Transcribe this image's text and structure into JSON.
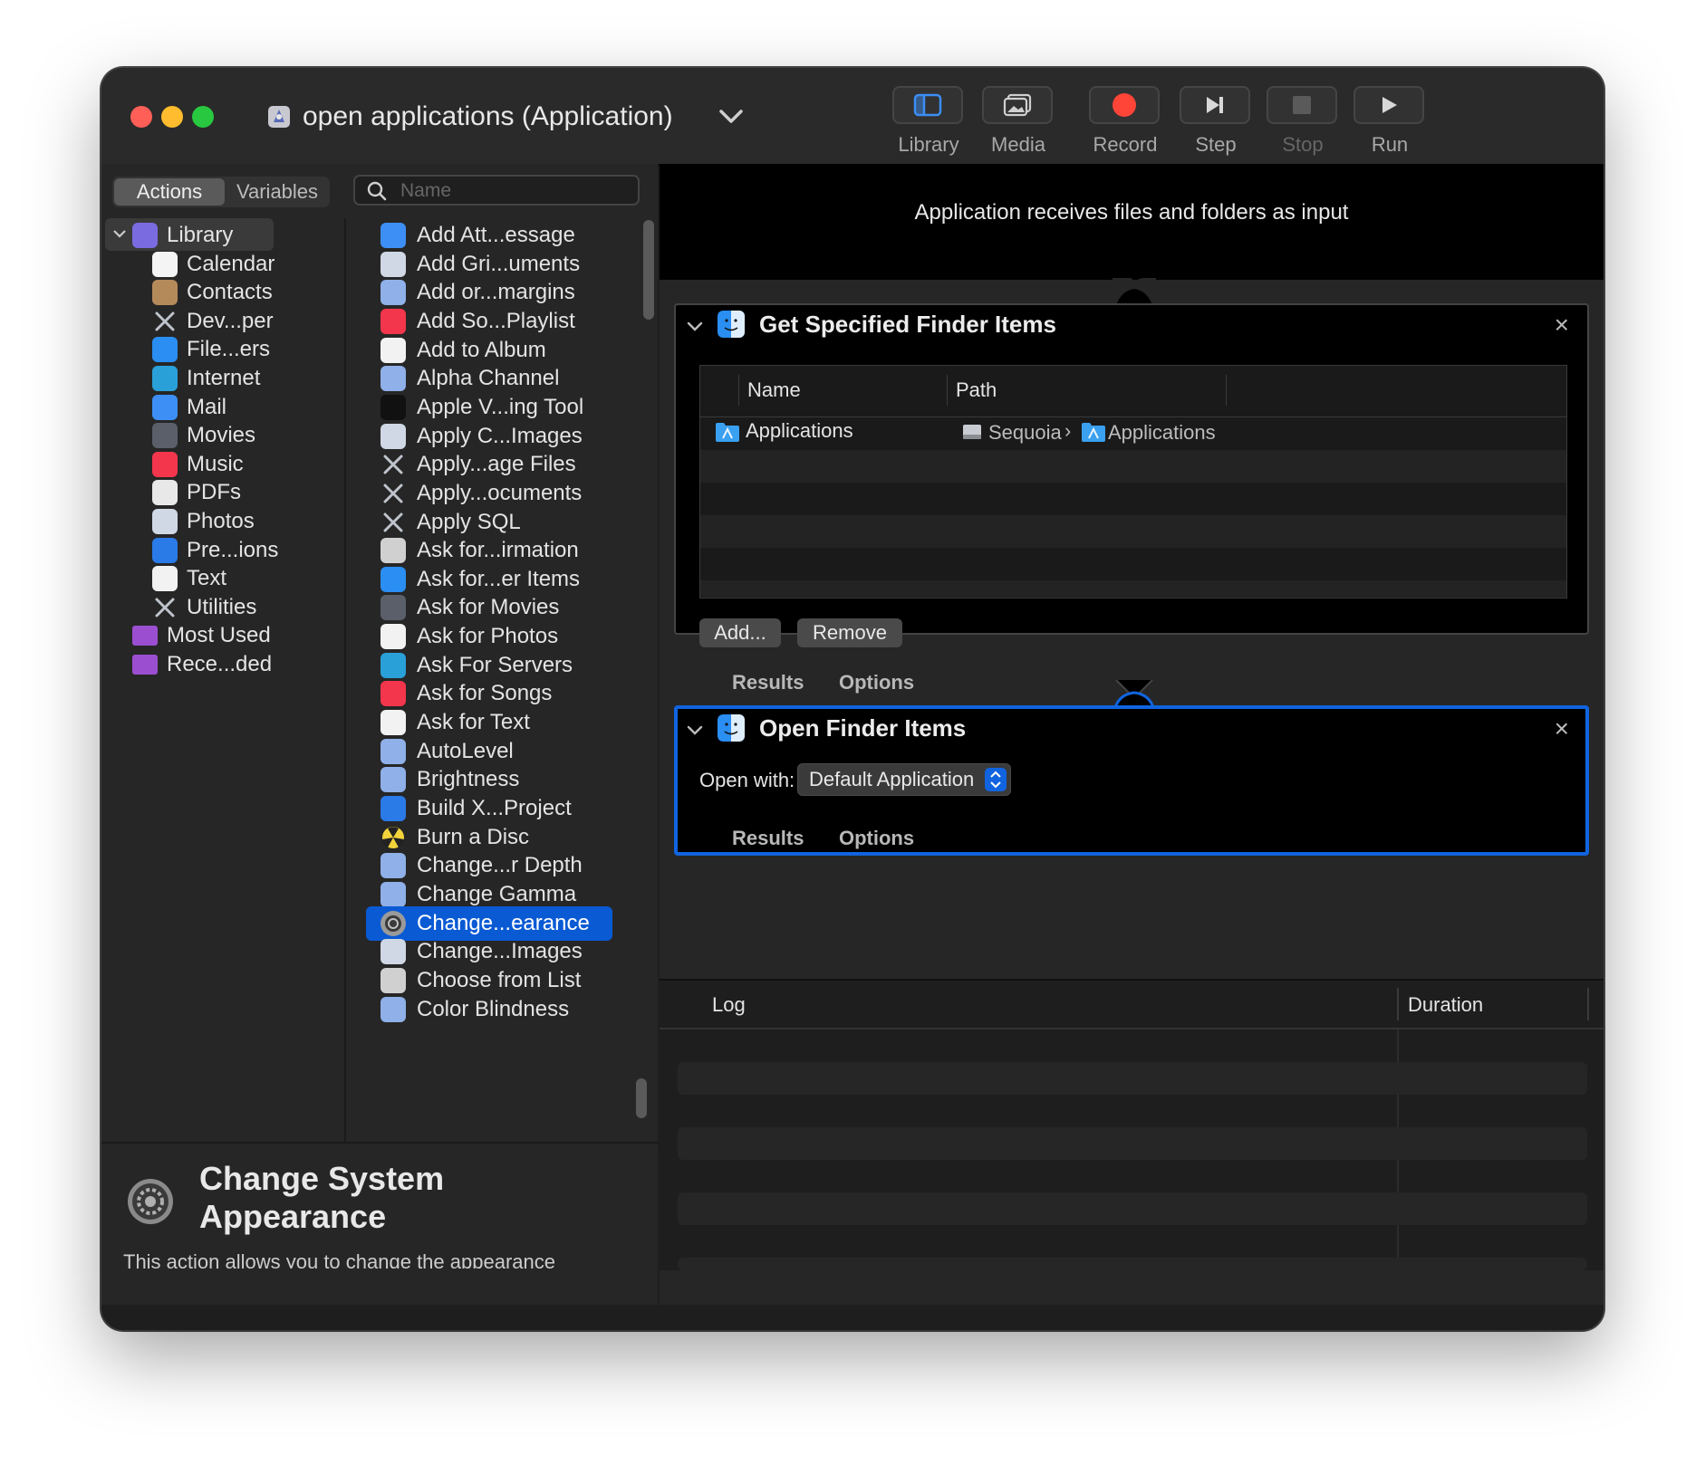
{
  "window": {
    "title": "open applications (Application)"
  },
  "toolbar": {
    "library": "Library",
    "media": "Media",
    "record": "Record",
    "step": "Step",
    "stop": "Stop",
    "run": "Run"
  },
  "sidebar": {
    "tab_actions": "Actions",
    "tab_variables": "Variables",
    "search_placeholder": "Name",
    "library": [
      {
        "label": "Library",
        "icon": "library-icon",
        "color": "#7a6be0"
      },
      {
        "label": "Calendar",
        "icon": "calendar-icon",
        "color": "#f4f4f4"
      },
      {
        "label": "Contacts",
        "icon": "contacts-icon",
        "color": "#b58a5a"
      },
      {
        "label": "Dev...per",
        "icon": "developer-icon",
        "color": "#262626"
      },
      {
        "label": "File...ers",
        "icon": "finder-icon",
        "color": "#2a8ef2"
      },
      {
        "label": "Internet",
        "icon": "internet-icon",
        "color": "#2aa0d8"
      },
      {
        "label": "Mail",
        "icon": "mail-icon",
        "color": "#3d8ff5"
      },
      {
        "label": "Movies",
        "icon": "movies-icon",
        "color": "#5a5f6a"
      },
      {
        "label": "Music",
        "icon": "music-icon",
        "color": "#f4364c"
      },
      {
        "label": "PDFs",
        "icon": "pdf-icon",
        "color": "#e8e8e8"
      },
      {
        "label": "Photos",
        "icon": "photos-icon",
        "color": "#cfd8e4"
      },
      {
        "label": "Pre...ions",
        "icon": "presentations-icon",
        "color": "#2a7ae8"
      },
      {
        "label": "Text",
        "icon": "text-icon",
        "color": "#f2f2f2"
      },
      {
        "label": "Utilities",
        "icon": "utilities-icon",
        "color": "#262626"
      },
      {
        "label": "Most Used",
        "icon": "folder-icon",
        "color": "#9b4fd0"
      },
      {
        "label": "Rece...ded",
        "icon": "folder-icon",
        "color": "#9b4fd0"
      }
    ],
    "actions": [
      {
        "label": "Add Att...essage",
        "icon": "mail-icon",
        "color": "#3d8ff5"
      },
      {
        "label": "Add Gri...uments",
        "icon": "preview-icon",
        "color": "#cfd8e4"
      },
      {
        "label": "Add or...margins",
        "icon": "image-icon",
        "color": "#8fb0e8"
      },
      {
        "label": "Add So...Playlist",
        "icon": "music-icon",
        "color": "#f4364c"
      },
      {
        "label": "Add to Album",
        "icon": "photos-icon",
        "color": "#f2f2f2"
      },
      {
        "label": "Alpha Channel",
        "icon": "image-icon",
        "color": "#8fb0e8"
      },
      {
        "label": "Apple V...ing Tool",
        "icon": "terminal-icon",
        "color": "#111111"
      },
      {
        "label": "Apply C...Images",
        "icon": "preview-icon",
        "color": "#cfd8e4"
      },
      {
        "label": "Apply...age Files",
        "icon": "tools-icon",
        "color": "#262626"
      },
      {
        "label": "Apply...ocuments",
        "icon": "tools-icon",
        "color": "#262626"
      },
      {
        "label": "Apply SQL",
        "icon": "tools-icon",
        "color": "#262626"
      },
      {
        "label": "Ask for...irmation",
        "icon": "automator-icon",
        "color": "#d0d0d0"
      },
      {
        "label": "Ask for...er Items",
        "icon": "finder-icon",
        "color": "#2a8ef2"
      },
      {
        "label": "Ask for Movies",
        "icon": "movies-icon",
        "color": "#5a5f6a"
      },
      {
        "label": "Ask for Photos",
        "icon": "photos-icon",
        "color": "#f2f2f2"
      },
      {
        "label": "Ask For Servers",
        "icon": "internet-icon",
        "color": "#2aa0d8"
      },
      {
        "label": "Ask for Songs",
        "icon": "music-icon",
        "color": "#f4364c"
      },
      {
        "label": "Ask for Text",
        "icon": "text-icon",
        "color": "#f2f2f2"
      },
      {
        "label": "AutoLevel",
        "icon": "image-icon",
        "color": "#8fb0e8"
      },
      {
        "label": "Brightness",
        "icon": "image-icon",
        "color": "#8fb0e8"
      },
      {
        "label": "Build X...Project",
        "icon": "xcode-icon",
        "color": "#2a7ae8"
      },
      {
        "label": "Burn a Disc",
        "icon": "burn-icon",
        "color": "#f2d33a"
      },
      {
        "label": "Change...r Depth",
        "icon": "image-icon",
        "color": "#8fb0e8"
      },
      {
        "label": "Change Gamma",
        "icon": "image-icon",
        "color": "#8fb0e8"
      },
      {
        "label": "Change...earance",
        "icon": "settings-icon",
        "color": "#9a9a9a",
        "selected": true
      },
      {
        "label": "Change...Images",
        "icon": "preview-icon",
        "color": "#cfd8e4"
      },
      {
        "label": "Choose from List",
        "icon": "automator-icon",
        "color": "#d0d0d0"
      },
      {
        "label": "Color Blindness",
        "icon": "image-icon",
        "color": "#8fb0e8"
      }
    ],
    "description": {
      "title": "Change System Appearance",
      "text": "This action allows you to change the appearance"
    }
  },
  "workflow": {
    "banner": "Application receives files and folders as input",
    "actions": [
      {
        "title": "Get Specified Finder Items",
        "columns": [
          "Name",
          "Path"
        ],
        "row": {
          "name": "Applications",
          "path_disk": "Sequoia",
          "path_sep": "›",
          "path_folder": "Applications"
        },
        "add_button": "Add...",
        "remove_button": "Remove",
        "tab_results": "Results",
        "tab_options": "Options"
      },
      {
        "title": "Open Finder Items",
        "open_with_label": "Open with:",
        "open_with_value": "Default Application",
        "tab_results": "Results",
        "tab_options": "Options"
      }
    ]
  },
  "log": {
    "col_log": "Log",
    "col_duration": "Duration"
  },
  "colors": {
    "accent": "#0a5ad4",
    "close": "#ff5f57",
    "minimize": "#febc2e",
    "zoom": "#28c840",
    "record": "#ff4438"
  }
}
